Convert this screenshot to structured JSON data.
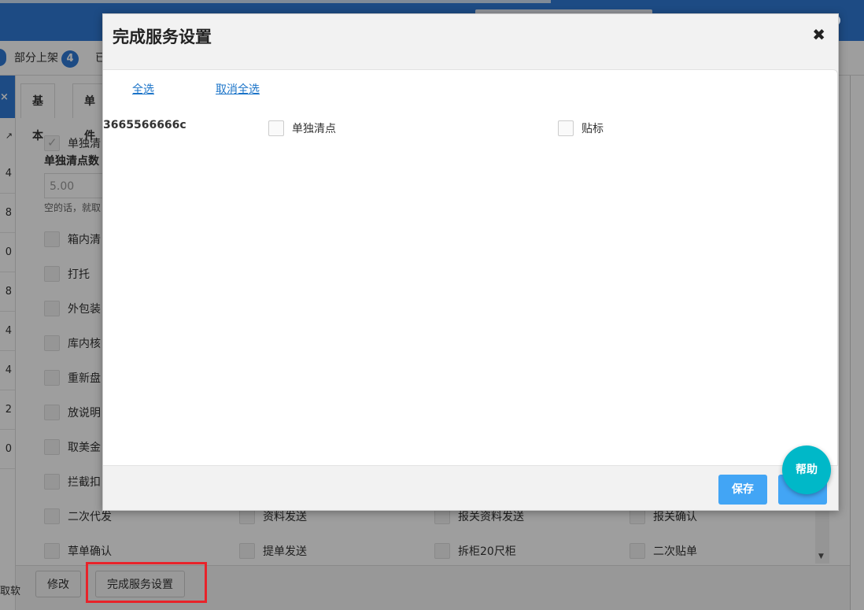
{
  "background": {
    "tabs": [
      {
        "label": "部分上架",
        "badge": "4"
      },
      {
        "label": "已"
      }
    ],
    "left_numbers": [
      "4",
      "8",
      "0",
      "8",
      "4",
      "4",
      "2",
      "0"
    ],
    "left_close": "×",
    "left_expand": "↗",
    "inner_tabs": [
      "基本",
      "单件"
    ],
    "first_check_label": "单独清",
    "field_label": "单独清点数",
    "field_value": "5.00",
    "field_hint": "空的话，就取",
    "services_col1": [
      "箱内清",
      "打托",
      "外包装",
      "库内核",
      "重新盘",
      "放说明",
      "取美金",
      "拦截扣"
    ],
    "row_a": [
      "二次代发",
      "资料发送",
      "报关资料发送",
      "报关确认"
    ],
    "row_b": [
      "草单确认",
      "提单发送",
      "拆柜20尺柜",
      "二次贴单"
    ],
    "footer_buttons": {
      "edit": "修改",
      "finish_service": "完成服务设置"
    },
    "left_cut_text": "取软"
  },
  "modal": {
    "title": "完成服务设置",
    "close_glyph": "✖",
    "select_all": "全选",
    "deselect_all": "取消全选",
    "item_code": "3665566666c",
    "options": [
      {
        "label": "单独清点",
        "checked": false
      },
      {
        "label": "贴标",
        "checked": false
      }
    ],
    "save_label": "保存",
    "second_button_label": "",
    "help_label": "帮助"
  },
  "colors": {
    "brand_blue": "#2f7ad6",
    "primary_button": "#42a5f5",
    "help_button": "#00b8c8",
    "highlight_red": "#e8232a"
  }
}
